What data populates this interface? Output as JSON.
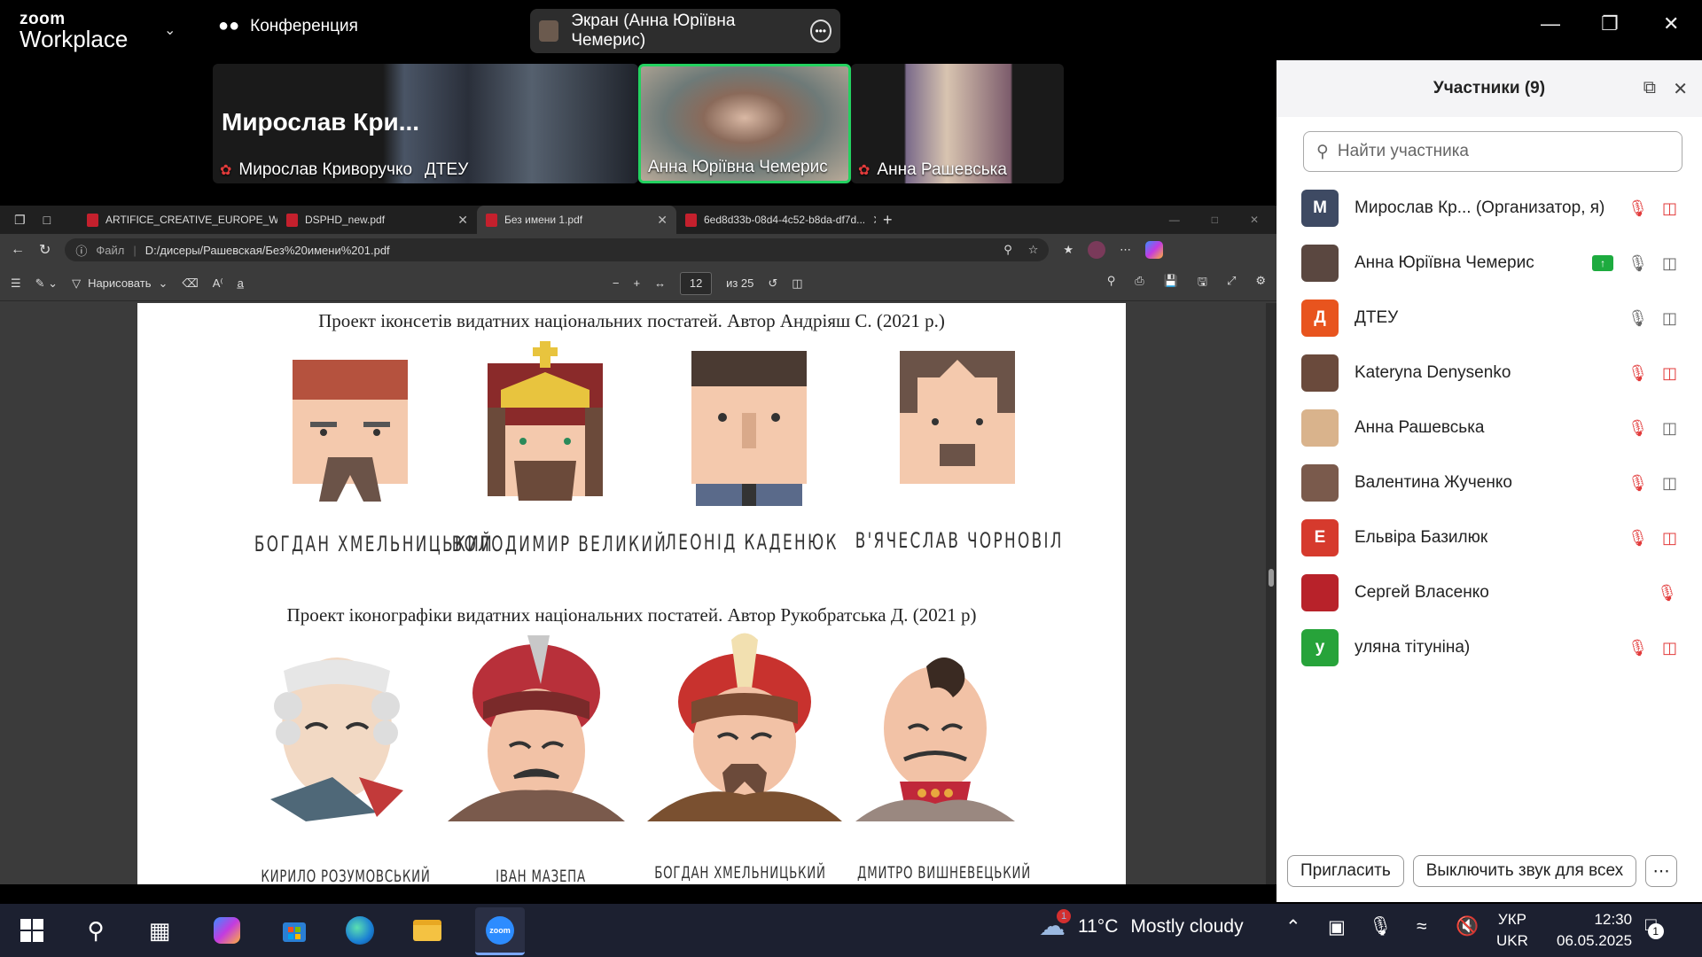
{
  "zoom": {
    "logo_top": "zoom",
    "logo_bottom": "Workplace",
    "meeting_label": "Конференция",
    "share_label": "Экран (Анна Юріївна Чемерис)"
  },
  "video_tiles": [
    {
      "big_name": "Мирослав  Кри...",
      "name": "Мирослав Криворучко",
      "extra": "ДТЕУ"
    },
    {
      "name": "Анна Юріївна Чемерис"
    },
    {
      "name": "Анна Рашевська"
    }
  ],
  "browser": {
    "tabs": [
      {
        "label": "ARTIFICE_CREATIVE_EUROPE_WP..."
      },
      {
        "label": "DSPHD_new.pdf"
      },
      {
        "label": "Без имени 1.pdf"
      },
      {
        "label": "6ed8d33b-08d4-4c52-b8da-df7d..."
      }
    ],
    "url_prefix": "Файл",
    "url": "D:/дисеры/Рашевская/Без%20имени%201.pdf",
    "draw_label": "Нарисовать",
    "page_number": "12",
    "page_total": "из 25"
  },
  "pdf": {
    "caption1": "Проект іконсетів видатних національних постатей. Автор Андріяш С. (2021 р.)",
    "caption2": "Проект іконографіки видатних національних постатей. Автор Рукобратська Д. (2021 р)",
    "row1_names": [
      "БОГДАН ХМЕЛЬНИЦЬКИЙ",
      "ВОЛОДИМИР ВЕЛИКИЙ",
      "ЛЕОНІД КАДЕНЮК",
      "В'ЯЧЕСЛАВ ЧОРНОВІЛ"
    ],
    "row2_names": [
      "КИРИЛО РОЗУМОВСЬКИЙ",
      "ІВАН МАЗЕПА",
      "БОГДАН ХМЕЛЬНИЦЬКИЙ",
      "ДМИТРО ВИШНЕВЕЦЬКИЙ"
    ]
  },
  "participants_panel": {
    "title": "Участники (9)",
    "search_placeholder": "Найти участника",
    "participants": [
      {
        "initial": "М",
        "name": "Мирослав Кр... (Организатор, я)",
        "color": "#3e4a63"
      },
      {
        "initial": "",
        "name": "Анна Юріївна Чемерис",
        "color": "#5a4740"
      },
      {
        "initial": "Д",
        "name": "ДТЕУ",
        "color": "#e8541e"
      },
      {
        "initial": "",
        "name": "Kateryna Denysenko",
        "color": "#6a4a3c"
      },
      {
        "initial": "",
        "name": "Анна Рашевська",
        "color": "#d9b38c"
      },
      {
        "initial": "",
        "name": "Валентина Жученко",
        "color": "#7a5a4c"
      },
      {
        "initial": "Е",
        "name": "Ельвіра Базилюк",
        "color": "#d63a2d"
      },
      {
        "initial": "",
        "name": "Сергей Власенко",
        "color": "#b8222a"
      },
      {
        "initial": "у",
        "name": "уляна тітуніна)",
        "color": "#27a33a"
      }
    ],
    "invite_label": "Пригласить",
    "mute_all_label": "Выключить звук для всех"
  },
  "taskbar": {
    "weather_temp": "11°C",
    "weather_text": "Mostly cloudy",
    "weather_badge": "1",
    "lang_top": "УКР",
    "lang_bottom": "UKR",
    "time": "12:30",
    "date": "06.05.2025",
    "notif_count": "1"
  }
}
